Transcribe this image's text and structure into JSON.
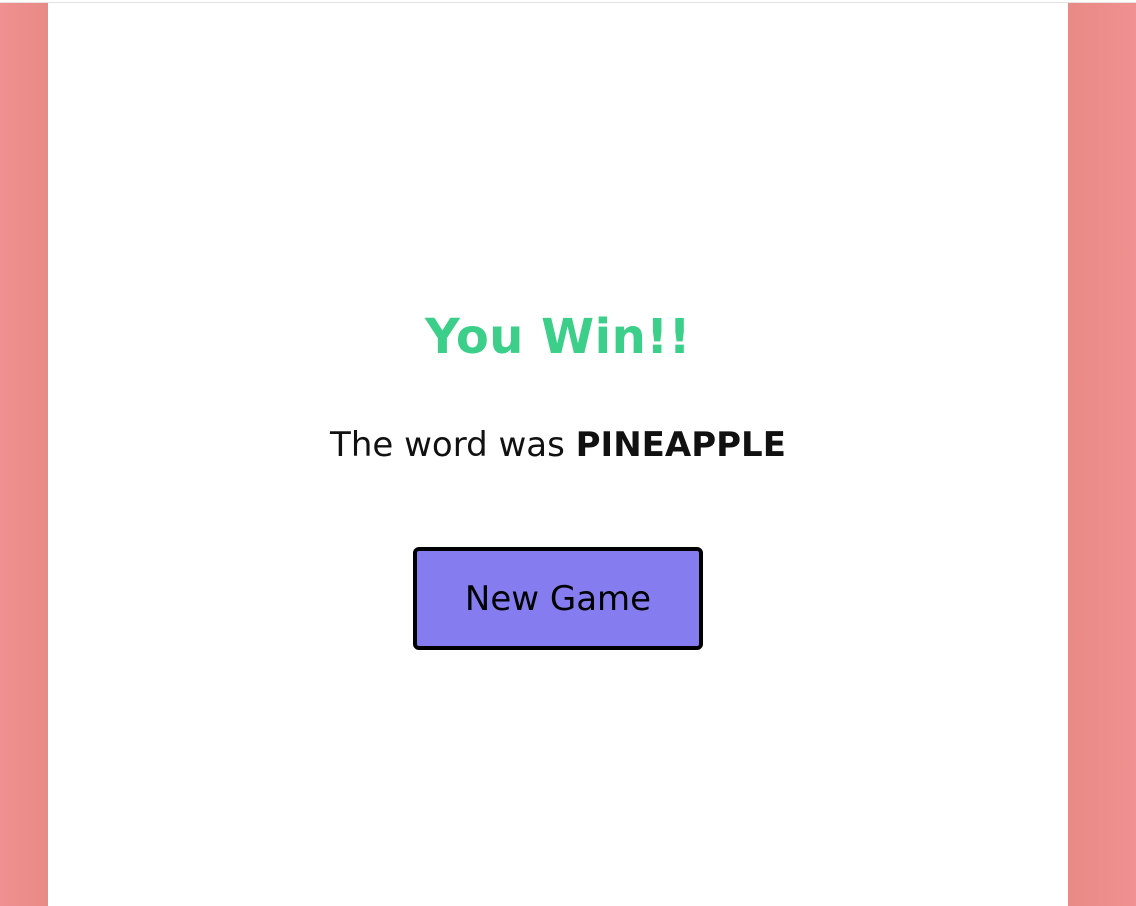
{
  "result": {
    "title": "You Win!!",
    "message_prefix": "The word was",
    "word": "PINEAPPLE"
  },
  "actions": {
    "new_game_label": "New Game"
  },
  "colors": {
    "background": "#ef8e8e",
    "card": "#ffffff",
    "win_text": "#3ccf8a",
    "button": "#857cef",
    "button_border": "#000000"
  }
}
